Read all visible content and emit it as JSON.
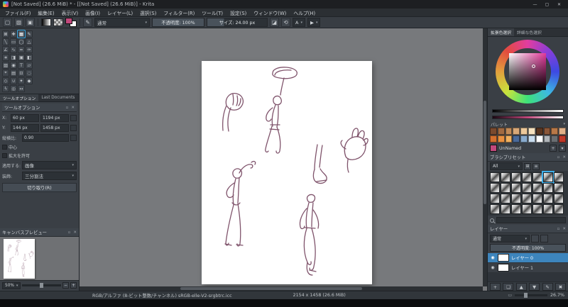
{
  "colors": {
    "accent": "#3daee9",
    "fg": "#c2487c",
    "sketch": "#6e3c57",
    "canvas_bg": "#77797c"
  },
  "chrome": {
    "caret": "▾",
    "float": "▫",
    "close": "✕"
  },
  "titlebar": {
    "title": "[Not Saved] (26.6 MiB) * - [[Not Saved] (26.6 MiB)] - Krita",
    "minimize": "—",
    "maximize": "▢",
    "close": "✕"
  },
  "menubar": {
    "items": [
      "ファイル(F)",
      "編集(E)",
      "表示(V)",
      "画像(I)",
      "レイヤー(L)",
      "選択(S)",
      "フィルター(R)",
      "ツール(T)",
      "設定(S)",
      "ウィンドウ(W)",
      "ヘルプ(H)"
    ]
  },
  "toolbar": {
    "new_glyph": "▢",
    "open_glyph": "▧",
    "save_glyph": "▣",
    "brush_glyph": "✎",
    "blend_mode": "通常",
    "opacity_text": "不透明度: 100%",
    "size_text": "サイズ: 24.00 px",
    "eraser_glyph": "◪",
    "reload_glyph": "⟲",
    "workspace_glyph": "A",
    "tool_glyph": "▶"
  },
  "toolbox": {
    "tools": [
      {
        "name": "transform",
        "glyph": "⊠"
      },
      {
        "name": "move",
        "glyph": "✚"
      },
      {
        "name": "crop",
        "glyph": "▦",
        "selected": true
      },
      {
        "name": "freehand-brush",
        "glyph": "✎"
      },
      {
        "name": "line",
        "glyph": "╲"
      },
      {
        "name": "rectangle",
        "glyph": "▭"
      },
      {
        "name": "ellipse",
        "glyph": "◯"
      },
      {
        "name": "polygon",
        "glyph": "△"
      },
      {
        "name": "polyline",
        "glyph": "∠"
      },
      {
        "name": "bezier-curve",
        "glyph": "∿"
      },
      {
        "name": "freehand-path",
        "glyph": "≈"
      },
      {
        "name": "dynamic-brush",
        "glyph": "✑"
      },
      {
        "name": "multibrush",
        "glyph": "∗"
      },
      {
        "name": "fill",
        "glyph": "◨"
      },
      {
        "name": "enclose-fill",
        "glyph": "▣"
      },
      {
        "name": "gradient",
        "glyph": "◧"
      },
      {
        "name": "pattern-edit",
        "glyph": "▨"
      },
      {
        "name": "color-picker",
        "glyph": "◉"
      },
      {
        "name": "text",
        "glyph": "T"
      },
      {
        "name": "measure",
        "glyph": "▱"
      },
      {
        "name": "assistants",
        "glyph": "⌖"
      },
      {
        "name": "reference-images",
        "glyph": "▤"
      },
      {
        "name": "rectangular-select",
        "glyph": "⊡"
      },
      {
        "name": "elliptical-select",
        "glyph": "◌"
      },
      {
        "name": "polygonal-select",
        "glyph": "◇"
      },
      {
        "name": "freehand-select",
        "glyph": "∪"
      },
      {
        "name": "similar-color-select",
        "glyph": "✦"
      },
      {
        "name": "bezier-select",
        "glyph": "◆"
      },
      {
        "name": "magnetic-select",
        "glyph": "ϟ"
      },
      {
        "name": "zoom",
        "glyph": "◎"
      },
      {
        "name": "pan",
        "glyph": "↔"
      }
    ]
  },
  "left_tabs": [
    "ツールオプション",
    "Last Documents"
  ],
  "tool_options": {
    "title": "ツールオプション",
    "x_label": "X:",
    "x_value": "60 px",
    "w_value": "1194 px",
    "y_label": "Y:",
    "y_value": "144 px",
    "h_value": "1458 px",
    "ratio_label": "縦横比:",
    "ratio_value": "0.90",
    "center_label": "中心",
    "grow_label": "拡大を許可",
    "apply_label": "適用する:",
    "apply_value": "画像",
    "deco_label": "装飾:",
    "deco_value": "三分割法",
    "crop_button": "切り取り(R)"
  },
  "overview": {
    "title": "キャンバスプレビュー",
    "zoom": "50%",
    "minus": "−",
    "plus": "+"
  },
  "color_selector": {
    "tabs": [
      "拡張色選択",
      "詳細な色選択"
    ],
    "palette_label": "パレット",
    "palette_row1": [
      "#7a4a2e",
      "#a06a42",
      "#c08a58",
      "#d8a878",
      "#ecc89a",
      "#f6e2c0",
      "#5a3620",
      "#8a5638",
      "#b87848",
      "#e0b088"
    ],
    "palette_row2": [
      "#d4702e",
      "#e89040",
      "#f0b060",
      "#4a6a9a",
      "#88aacc",
      "#c8dcee",
      "#ffffff",
      "#b0b4b8",
      "#6a6e72",
      "#c03828"
    ],
    "color_name": "UnNamed",
    "add_glyph": "+"
  },
  "brush_presets": {
    "title": "ブラシプリセット",
    "tag_filter": "All",
    "view_glyphs": [
      "⊞",
      "≡"
    ],
    "cells": 28,
    "selected_index": 5
  },
  "layers": {
    "title": "レイヤー",
    "blend_mode": "通常",
    "opacity_text": "不透明度: 100%",
    "eye_glyph": "◉",
    "items": [
      {
        "name": "レイヤー 0",
        "selected": true
      },
      {
        "name": "レイヤー 1"
      }
    ],
    "buttons": [
      {
        "name": "add",
        "glyph": "+"
      },
      {
        "name": "duplicate",
        "glyph": "❏"
      },
      {
        "name": "move-up",
        "glyph": "▲"
      },
      {
        "name": "move-down",
        "glyph": "▼"
      },
      {
        "name": "properties",
        "glyph": "✎"
      },
      {
        "name": "delete",
        "glyph": "✖"
      }
    ]
  },
  "statusbar": {
    "profile": "RGB/アルファ (8-ビット整数/チャンネル)  sRGB-elle-V2-srgbtrc.icc",
    "size": "2154 x 1458 (26.6 MiB)",
    "zoom": "26.7%"
  }
}
